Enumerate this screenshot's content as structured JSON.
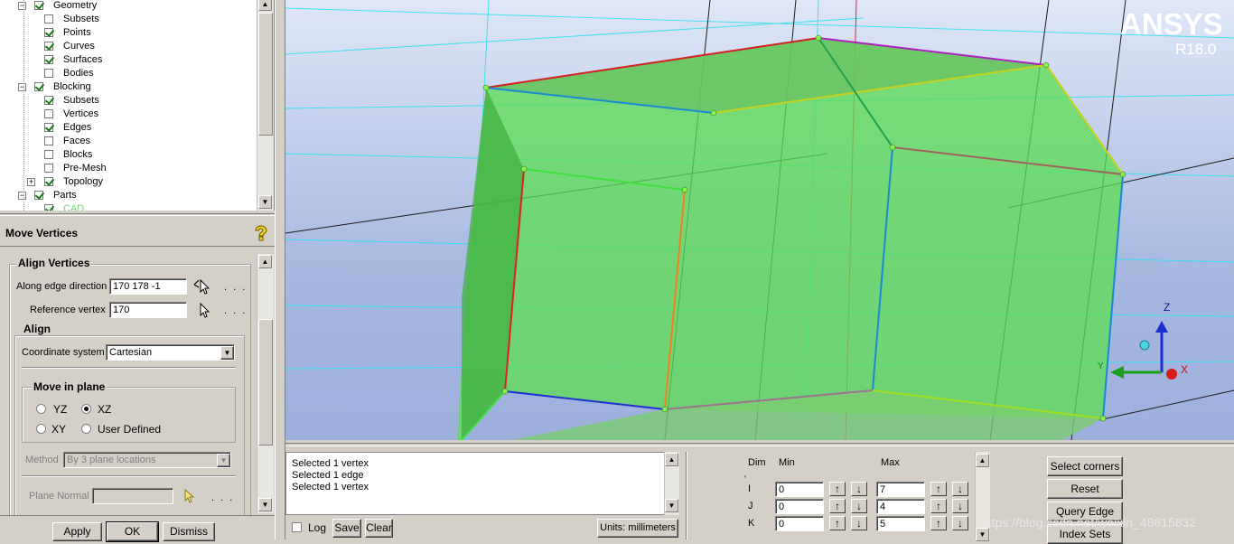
{
  "tree": {
    "items": [
      {
        "label": "Geometry",
        "indent": 1,
        "checked": true,
        "expander": "−"
      },
      {
        "label": "Subsets",
        "indent": 2,
        "checked": false
      },
      {
        "label": "Points",
        "indent": 2,
        "checked": true
      },
      {
        "label": "Curves",
        "indent": 2,
        "checked": true
      },
      {
        "label": "Surfaces",
        "indent": 2,
        "checked": true
      },
      {
        "label": "Bodies",
        "indent": 2,
        "checked": false
      },
      {
        "label": "Blocking",
        "indent": 1,
        "checked": true,
        "expander": "−"
      },
      {
        "label": "Subsets",
        "indent": 2,
        "checked": true
      },
      {
        "label": "Vertices",
        "indent": 2,
        "checked": false
      },
      {
        "label": "Edges",
        "indent": 2,
        "checked": true
      },
      {
        "label": "Faces",
        "indent": 2,
        "checked": false
      },
      {
        "label": "Blocks",
        "indent": 2,
        "checked": false
      },
      {
        "label": "Pre-Mesh",
        "indent": 2,
        "checked": false
      },
      {
        "label": "Topology",
        "indent": 2,
        "checked": true,
        "expander": "+"
      },
      {
        "label": "Parts",
        "indent": 1,
        "checked": true,
        "expander": "−"
      },
      {
        "label": "CAD",
        "indent": 2,
        "checked": true,
        "partial": true
      }
    ]
  },
  "panel": {
    "title": "Move Vertices",
    "align_vertices": {
      "title": "Align Vertices",
      "along_edge_label": "Along edge direction",
      "along_edge_value": "170 178 -1",
      "ref_vertex_label": "Reference vertex",
      "ref_vertex_value": "170",
      "dots": ". . ."
    },
    "align": {
      "title": "Align",
      "coord_label": "Coordinate system",
      "coord_value": "Cartesian",
      "move_in_plane": {
        "title": "Move in plane",
        "options": [
          "YZ",
          "XZ",
          "XY",
          "User Defined"
        ],
        "selected": "XZ"
      },
      "method_label": "Method",
      "method_value": "By 3 plane locations",
      "plane_normal_label": "Plane Normal"
    },
    "buttons": {
      "apply": "Apply",
      "ok": "OK",
      "dismiss": "Dismiss"
    }
  },
  "viewport": {
    "brand": "ANSYS",
    "version": "R18.0",
    "axes": {
      "z": "Z",
      "x": "X",
      "y": "Y"
    }
  },
  "messages": {
    "lines": [
      "Selected 1 vertex",
      "Selected 1 edge",
      "Selected 1 vertex"
    ],
    "log_label": "Log",
    "save_label": "Save",
    "clear_label": "Clear",
    "units_label": "Units: millimeters"
  },
  "index_grid": {
    "headers": {
      "dim": "Dim",
      "min": "Min",
      "max": "Max"
    },
    "rows": [
      {
        "dim": "I",
        "min": "0",
        "max": "7"
      },
      {
        "dim": "J",
        "min": "0",
        "max": "4"
      },
      {
        "dim": "K",
        "min": "0",
        "max": "5"
      }
    ]
  },
  "right_buttons": {
    "select_corners": "Select corners",
    "reset": "Reset",
    "query_edge": "Query Edge",
    "index_sets": "Index Sets"
  },
  "watermark": "https://blog.csdn.net/weixin_48615832"
}
